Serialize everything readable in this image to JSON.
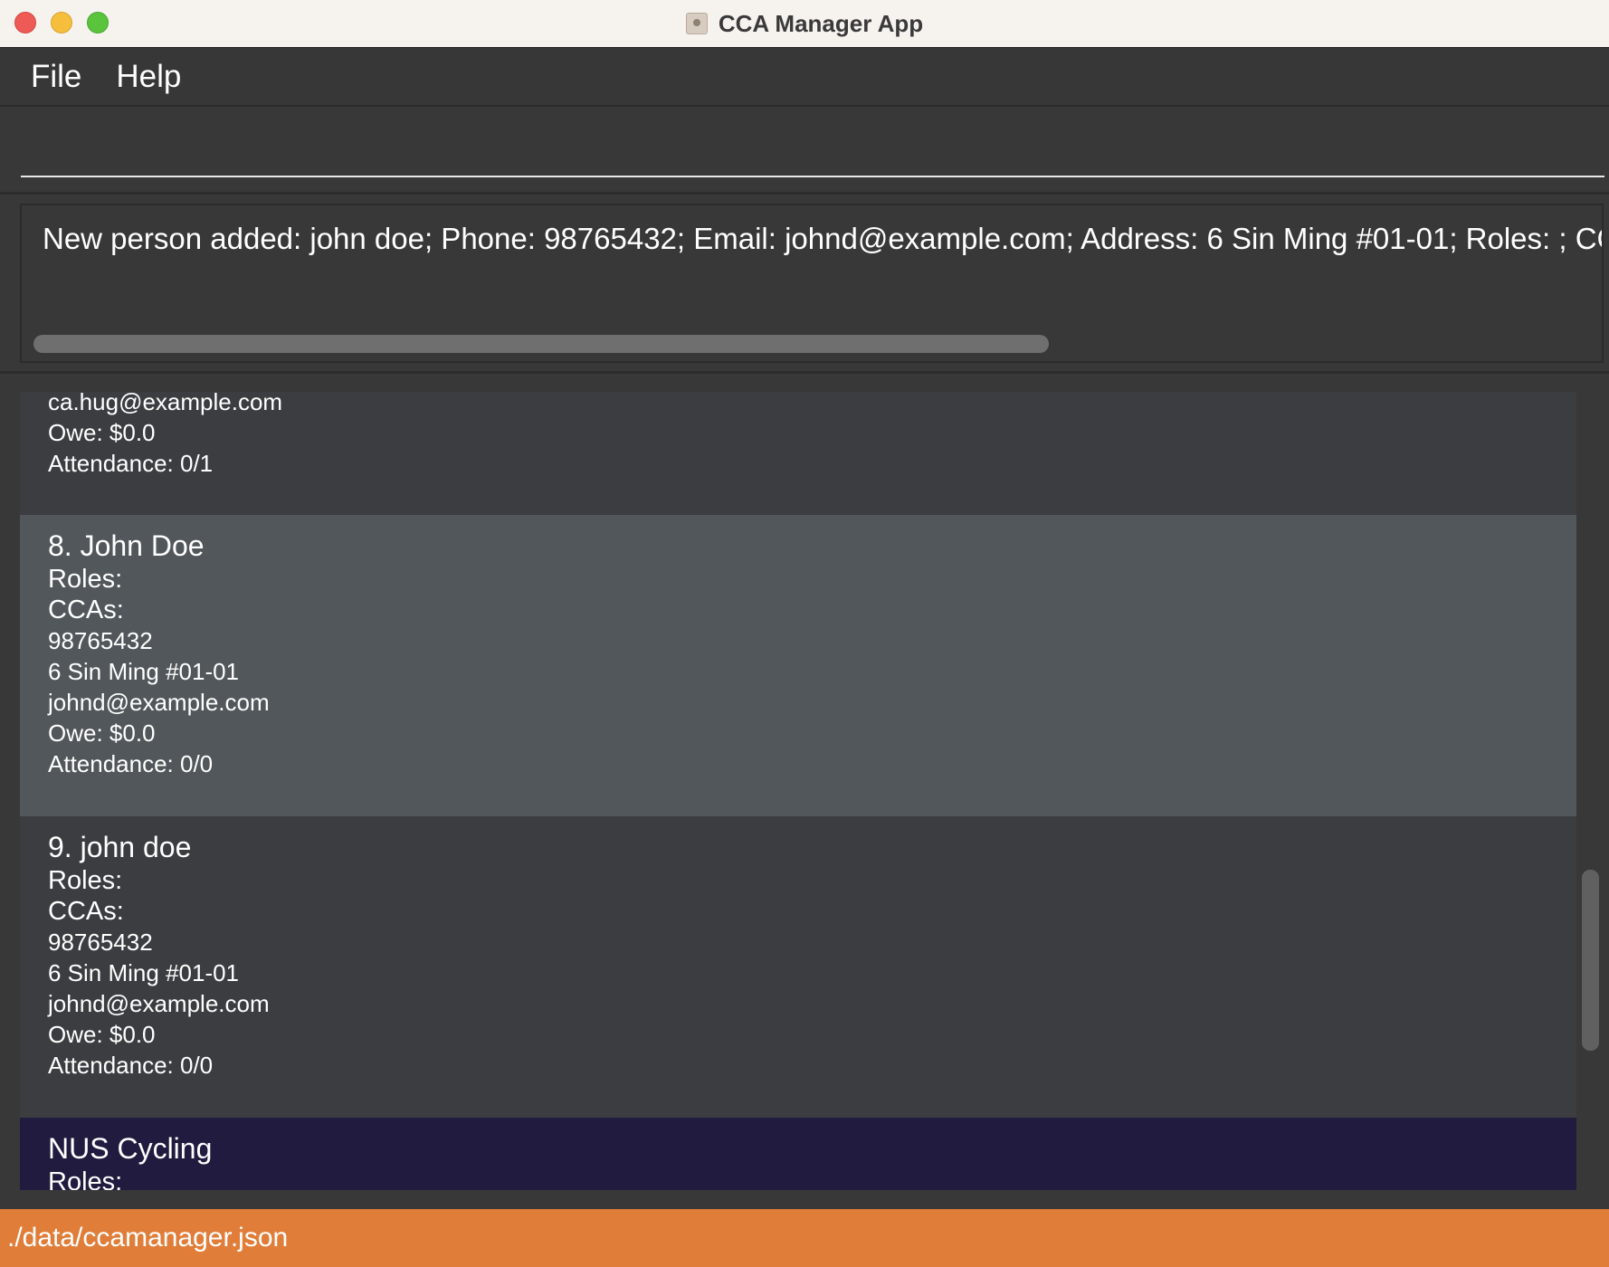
{
  "window": {
    "title": "CCA Manager App"
  },
  "menu": {
    "items": [
      {
        "label": "File"
      },
      {
        "label": "Help"
      }
    ]
  },
  "command": {
    "value": ""
  },
  "result": {
    "text": "New person added: john doe; Phone: 98765432; Email: johnd@example.com; Address: 6 Sin Ming #01-01; Roles: ; CCAs:"
  },
  "list": {
    "partial_card": {
      "email": "ca.hug@example.com",
      "owe": "Owe: $0.0",
      "attendance": "Attendance: 0/1"
    },
    "cards": [
      {
        "header": "8.  John Doe",
        "roles": "Roles:",
        "ccas": "CCAs:",
        "phone": "98765432",
        "address": "6 Sin Ming #01-01",
        "email": "johnd@example.com",
        "owe": "Owe: $0.0",
        "attendance": "Attendance: 0/0",
        "selected": true
      },
      {
        "header": "9.  john doe",
        "roles": "Roles:",
        "ccas": "CCAs:",
        "phone": "98765432",
        "address": "6 Sin Ming #01-01",
        "email": "johnd@example.com",
        "owe": "Owe: $0.0",
        "attendance": "Attendance: 0/0",
        "selected": false
      }
    ],
    "cca_card": {
      "name": "NUS Cycling",
      "roles": "Roles:"
    }
  },
  "status": {
    "path": "./data/ccamanager.json"
  },
  "colors": {
    "status_bar": "#e07d39",
    "selected_card": "#51575a",
    "cca_card": "#211b3f"
  }
}
